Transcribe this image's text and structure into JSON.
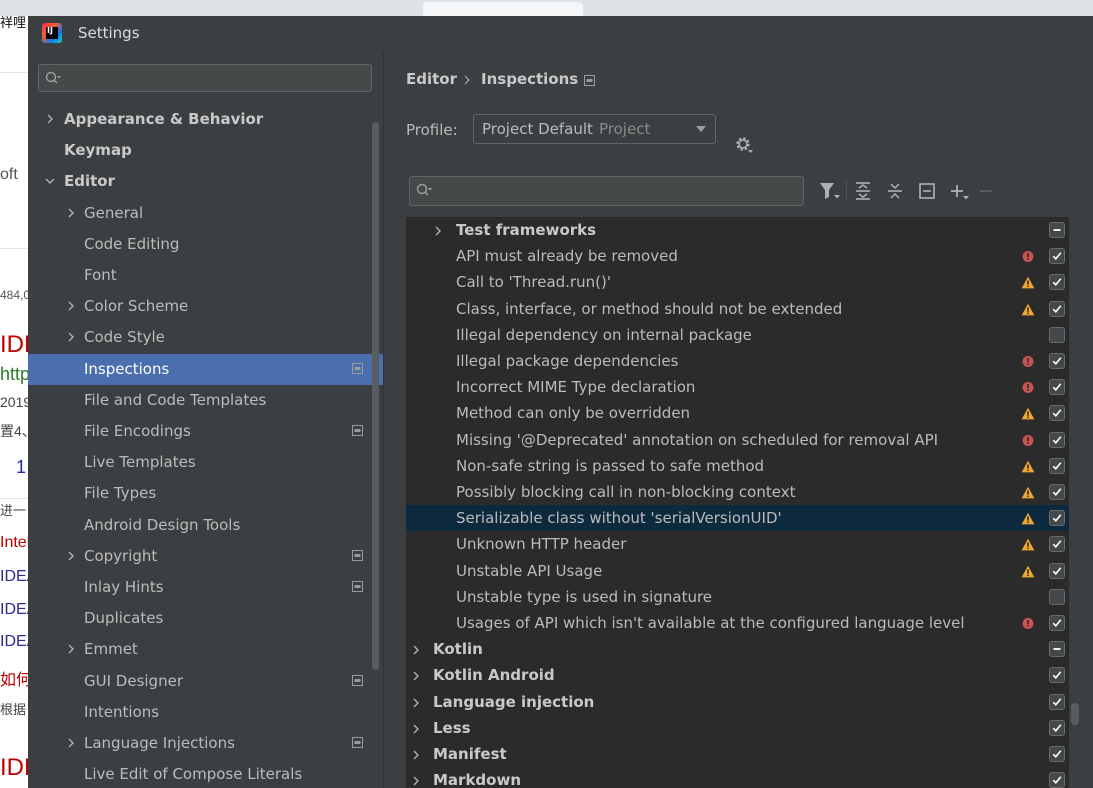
{
  "window": {
    "title": "Settings"
  },
  "search": {
    "placeholder": ""
  },
  "sidebar": {
    "items": [
      {
        "label": "Appearance & Behavior",
        "level": 0,
        "bold": true,
        "expandable": true,
        "expanded": false,
        "project_icon": false,
        "selected": false
      },
      {
        "label": "Keymap",
        "level": 0,
        "bold": true,
        "expandable": false,
        "expanded": false,
        "project_icon": false,
        "selected": false
      },
      {
        "label": "Editor",
        "level": 0,
        "bold": true,
        "expandable": true,
        "expanded": true,
        "project_icon": false,
        "selected": false
      },
      {
        "label": "General",
        "level": 1,
        "bold": false,
        "expandable": true,
        "expanded": false,
        "project_icon": false,
        "selected": false
      },
      {
        "label": "Code Editing",
        "level": 1,
        "bold": false,
        "expandable": false,
        "expanded": false,
        "project_icon": false,
        "selected": false
      },
      {
        "label": "Font",
        "level": 1,
        "bold": false,
        "expandable": false,
        "expanded": false,
        "project_icon": false,
        "selected": false
      },
      {
        "label": "Color Scheme",
        "level": 1,
        "bold": false,
        "expandable": true,
        "expanded": false,
        "project_icon": false,
        "selected": false
      },
      {
        "label": "Code Style",
        "level": 1,
        "bold": false,
        "expandable": true,
        "expanded": false,
        "project_icon": false,
        "selected": false
      },
      {
        "label": "Inspections",
        "level": 1,
        "bold": false,
        "expandable": false,
        "expanded": false,
        "project_icon": true,
        "selected": true
      },
      {
        "label": "File and Code Templates",
        "level": 1,
        "bold": false,
        "expandable": false,
        "expanded": false,
        "project_icon": false,
        "selected": false
      },
      {
        "label": "File Encodings",
        "level": 1,
        "bold": false,
        "expandable": false,
        "expanded": false,
        "project_icon": true,
        "selected": false
      },
      {
        "label": "Live Templates",
        "level": 1,
        "bold": false,
        "expandable": false,
        "expanded": false,
        "project_icon": false,
        "selected": false
      },
      {
        "label": "File Types",
        "level": 1,
        "bold": false,
        "expandable": false,
        "expanded": false,
        "project_icon": false,
        "selected": false
      },
      {
        "label": "Android Design Tools",
        "level": 1,
        "bold": false,
        "expandable": false,
        "expanded": false,
        "project_icon": false,
        "selected": false
      },
      {
        "label": "Copyright",
        "level": 1,
        "bold": false,
        "expandable": true,
        "expanded": false,
        "project_icon": true,
        "selected": false
      },
      {
        "label": "Inlay Hints",
        "level": 1,
        "bold": false,
        "expandable": false,
        "expanded": false,
        "project_icon": true,
        "selected": false
      },
      {
        "label": "Duplicates",
        "level": 1,
        "bold": false,
        "expandable": false,
        "expanded": false,
        "project_icon": false,
        "selected": false
      },
      {
        "label": "Emmet",
        "level": 1,
        "bold": false,
        "expandable": true,
        "expanded": false,
        "project_icon": false,
        "selected": false
      },
      {
        "label": "GUI Designer",
        "level": 1,
        "bold": false,
        "expandable": false,
        "expanded": false,
        "project_icon": true,
        "selected": false
      },
      {
        "label": "Intentions",
        "level": 1,
        "bold": false,
        "expandable": false,
        "expanded": false,
        "project_icon": false,
        "selected": false
      },
      {
        "label": "Language Injections",
        "level": 1,
        "bold": false,
        "expandable": true,
        "expanded": false,
        "project_icon": true,
        "selected": false
      },
      {
        "label": "Live Edit of Compose Literals",
        "level": 1,
        "bold": false,
        "expandable": false,
        "expanded": false,
        "project_icon": false,
        "selected": false
      }
    ]
  },
  "breadcrumb": {
    "parent": "Editor",
    "current": "Inspections"
  },
  "profile": {
    "label": "Profile:",
    "value": "Project Default",
    "scope": "Project"
  },
  "filter": {
    "placeholder": ""
  },
  "inspections": {
    "rows": [
      {
        "label": "Test frameworks",
        "kind": "group",
        "level": 1,
        "bold": true,
        "severity": "none",
        "check": "mixed",
        "selected": false
      },
      {
        "label": "API must already be removed",
        "kind": "item",
        "level": 2,
        "bold": false,
        "severity": "error",
        "check": "checked",
        "selected": false
      },
      {
        "label": "Call to 'Thread.run()'",
        "kind": "item",
        "level": 2,
        "bold": false,
        "severity": "warning",
        "check": "checked",
        "selected": false
      },
      {
        "label": "Class, interface, or method should not be extended",
        "kind": "item",
        "level": 2,
        "bold": false,
        "severity": "warning",
        "check": "checked",
        "selected": false
      },
      {
        "label": "Illegal dependency on internal package",
        "kind": "item",
        "level": 2,
        "bold": false,
        "severity": "none",
        "check": "unchecked",
        "selected": false
      },
      {
        "label": "Illegal package dependencies",
        "kind": "item",
        "level": 2,
        "bold": false,
        "severity": "error",
        "check": "checked",
        "selected": false
      },
      {
        "label": "Incorrect MIME Type declaration",
        "kind": "item",
        "level": 2,
        "bold": false,
        "severity": "error",
        "check": "checked",
        "selected": false
      },
      {
        "label": "Method can only be overridden",
        "kind": "item",
        "level": 2,
        "bold": false,
        "severity": "warning",
        "check": "checked",
        "selected": false
      },
      {
        "label": "Missing '@Deprecated' annotation on scheduled for removal API",
        "kind": "item",
        "level": 2,
        "bold": false,
        "severity": "error",
        "check": "checked",
        "selected": false
      },
      {
        "label": "Non-safe string is passed to safe method",
        "kind": "item",
        "level": 2,
        "bold": false,
        "severity": "warning",
        "check": "checked",
        "selected": false
      },
      {
        "label": "Possibly blocking call in non-blocking context",
        "kind": "item",
        "level": 2,
        "bold": false,
        "severity": "warning",
        "check": "checked",
        "selected": false
      },
      {
        "label": "Serializable class without 'serialVersionUID'",
        "kind": "item",
        "level": 2,
        "bold": false,
        "severity": "warning",
        "check": "checked",
        "selected": true
      },
      {
        "label": "Unknown HTTP header",
        "kind": "item",
        "level": 2,
        "bold": false,
        "severity": "warning",
        "check": "checked",
        "selected": false
      },
      {
        "label": "Unstable API Usage",
        "kind": "item",
        "level": 2,
        "bold": false,
        "severity": "warning",
        "check": "checked",
        "selected": false
      },
      {
        "label": "Unstable type is used in signature",
        "kind": "item",
        "level": 2,
        "bold": false,
        "severity": "none",
        "check": "unchecked",
        "selected": false
      },
      {
        "label": "Usages of API which isn't available at the configured language level",
        "kind": "item",
        "level": 2,
        "bold": false,
        "severity": "error",
        "check": "checked",
        "selected": false
      },
      {
        "label": "Kotlin",
        "kind": "group",
        "level": 0,
        "bold": true,
        "severity": "none",
        "check": "mixed",
        "selected": false
      },
      {
        "label": "Kotlin Android",
        "kind": "group",
        "level": 0,
        "bold": true,
        "severity": "none",
        "check": "checked",
        "selected": false
      },
      {
        "label": "Language injection",
        "kind": "group",
        "level": 0,
        "bold": true,
        "severity": "none",
        "check": "checked",
        "selected": false
      },
      {
        "label": "Less",
        "kind": "group",
        "level": 0,
        "bold": true,
        "severity": "none",
        "check": "checked",
        "selected": false
      },
      {
        "label": "Manifest",
        "kind": "group",
        "level": 0,
        "bold": true,
        "severity": "none",
        "check": "checked",
        "selected": false
      },
      {
        "label": "Markdown",
        "kind": "group",
        "level": 0,
        "bold": true,
        "severity": "none",
        "check": "checked",
        "selected": false
      }
    ]
  },
  "toolbar": {
    "buttons": [
      "filter-icon",
      "expand-all-icon",
      "collapse-all-icon",
      "reset-icon",
      "add-icon",
      "remove-icon"
    ]
  },
  "background_page": {
    "fragments": [
      "祥哩",
      "oft",
      "484,0",
      "IDE",
      "http",
      "2019",
      "置4、",
      "1",
      "进一",
      "Intel",
      "IDEA",
      "IDEA",
      "IDEA",
      "如何",
      "根据",
      "IDE"
    ]
  },
  "colors": {
    "dialog_bg": "#3c3f41",
    "list_bg": "#2b2b2b",
    "nav_selected": "#4b6eaf",
    "row_selected": "#0d293e",
    "text": "#bbbbbb",
    "error": "#c75450",
    "warning": "#f0a732",
    "check": "#ffffff"
  }
}
